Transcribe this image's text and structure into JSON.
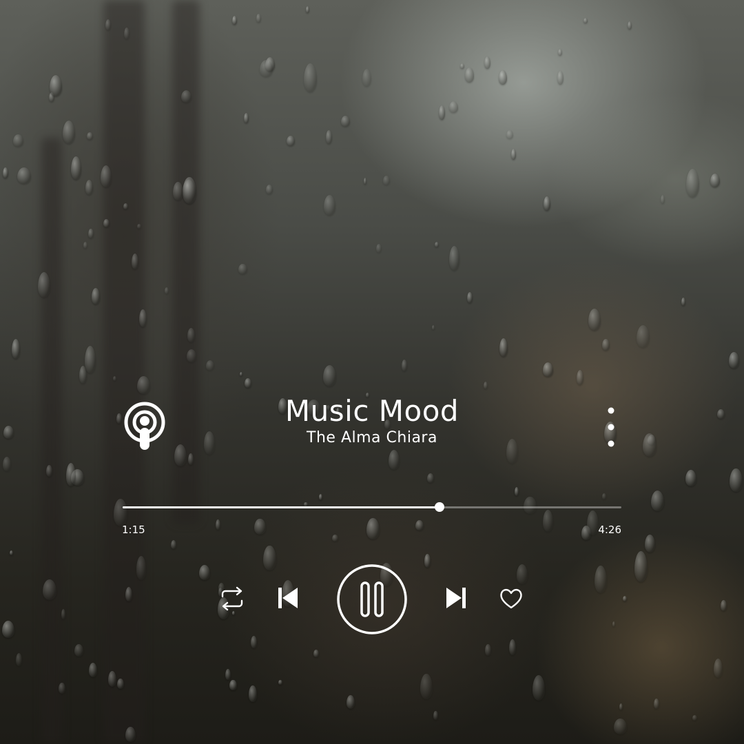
{
  "track": {
    "title": "Music Mood",
    "artist": "The Alma Chiara"
  },
  "progress": {
    "elapsed": "1:15",
    "total": "4:26",
    "fraction": 0.635
  },
  "icons": {
    "source": "podcast-icon",
    "menu": "more-vertical-icon",
    "repeat": "repeat-icon",
    "previous": "skip-previous-icon",
    "toggle": "pause-icon",
    "next": "skip-next-icon",
    "favorite": "heart-icon"
  },
  "colors": {
    "foreground": "#ffffff",
    "track_inactive": "rgba(255,255,255,0.35)"
  }
}
